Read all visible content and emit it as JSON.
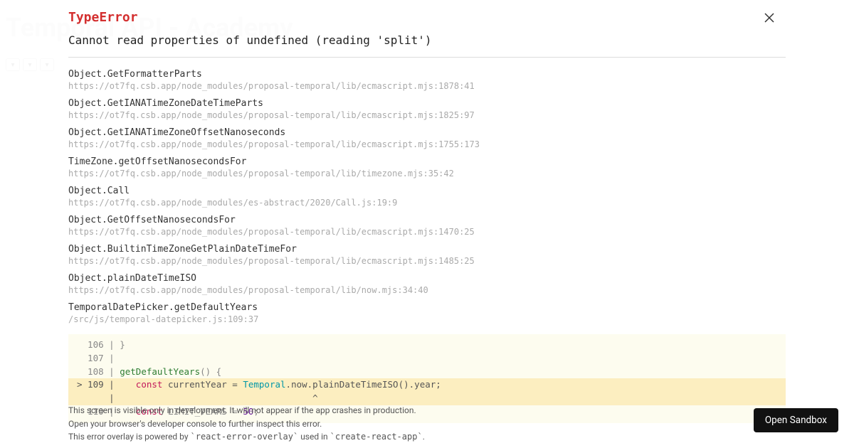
{
  "background": {
    "title": "Temporal API - Academy"
  },
  "error": {
    "type": "TypeError",
    "message": "Cannot read properties of undefined (reading 'split')"
  },
  "stack": [
    {
      "fn": "Object.GetFormatterParts",
      "loc": "https://ot7fq.csb.app/node_modules/proposal-temporal/lib/ecmascript.mjs:1878:41"
    },
    {
      "fn": "Object.GetIANATimeZoneDateTimeParts",
      "loc": "https://ot7fq.csb.app/node_modules/proposal-temporal/lib/ecmascript.mjs:1825:97"
    },
    {
      "fn": "Object.GetIANATimeZoneOffsetNanoseconds",
      "loc": "https://ot7fq.csb.app/node_modules/proposal-temporal/lib/ecmascript.mjs:1755:173"
    },
    {
      "fn": "TimeZone.getOffsetNanosecondsFor",
      "loc": "https://ot7fq.csb.app/node_modules/proposal-temporal/lib/timezone.mjs:35:42"
    },
    {
      "fn": "Object.Call",
      "loc": "https://ot7fq.csb.app/node_modules/es-abstract/2020/Call.js:19:9"
    },
    {
      "fn": "Object.GetOffsetNanosecondsFor",
      "loc": "https://ot7fq.csb.app/node_modules/proposal-temporal/lib/ecmascript.mjs:1470:25"
    },
    {
      "fn": "Object.BuiltinTimeZoneGetPlainDateTimeFor",
      "loc": "https://ot7fq.csb.app/node_modules/proposal-temporal/lib/ecmascript.mjs:1485:25"
    },
    {
      "fn": "Object.plainDateTimeISO",
      "loc": "https://ot7fq.csb.app/node_modules/proposal-temporal/lib/now.mjs:34:40"
    },
    {
      "fn": "TemporalDatePicker.getDefaultYears",
      "loc": "/src/js/temporal-datepicker.js:109:37"
    }
  ],
  "code": {
    "rows": [
      {
        "gutter": "  106 | ",
        "text_plain": "}"
      },
      {
        "gutter": "  107 | ",
        "text_plain": ""
      },
      {
        "gutter": "  108 | ",
        "fn": "getDefaultYears",
        "after_fn": "() {"
      },
      {
        "gutter": "> 109 | ",
        "hl": true,
        "kw": "const",
        "mid": " currentYear = ",
        "type": "Temporal",
        "tail": ".now.plainDateTimeISO().year;"
      },
      {
        "gutter": "      | ",
        "hl": true,
        "caret": "                                    ^"
      },
      {
        "gutter": "  110 | ",
        "kw": "const",
        "mid2": " LIMIT_YEARS = ",
        "num": "50",
        "semi": ";"
      }
    ]
  },
  "footer": {
    "line1": "This screen is visible only in development. It will not appear if the app crashes in production.",
    "line2": "Open your browser's developer console to further inspect this error.",
    "line3_a": "This error overlay is powered by ",
    "line3_b": "`react-error-overlay`",
    "line3_c": " used in ",
    "line3_d": "`create-react-app`",
    "line3_e": "."
  },
  "sandbox_button": "Open Sandbox"
}
